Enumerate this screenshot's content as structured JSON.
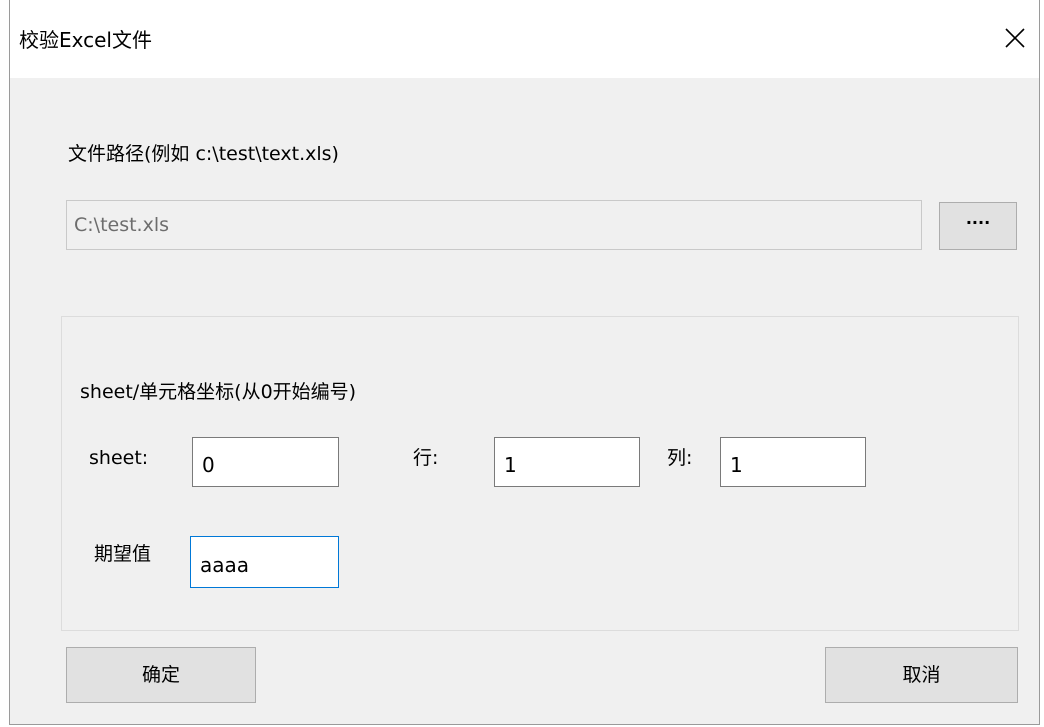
{
  "window": {
    "title": "校验Excel文件"
  },
  "file": {
    "path_label": "文件路径(例如 c:\\test\\text.xls)",
    "path_value": "C:\\test.xls",
    "browse_label": "····"
  },
  "cell": {
    "group_label": "sheet/单元格坐标(从0开始编号)",
    "sheet_label": "sheet:",
    "sheet_value": "0",
    "row_label": "行:",
    "row_value": "1",
    "col_label": "列:",
    "col_value": "1",
    "expected_label": "期望值",
    "expected_value": "aaaa"
  },
  "buttons": {
    "ok_label": "确定",
    "cancel_label": "取消"
  },
  "icons": {
    "close": "close-icon"
  }
}
